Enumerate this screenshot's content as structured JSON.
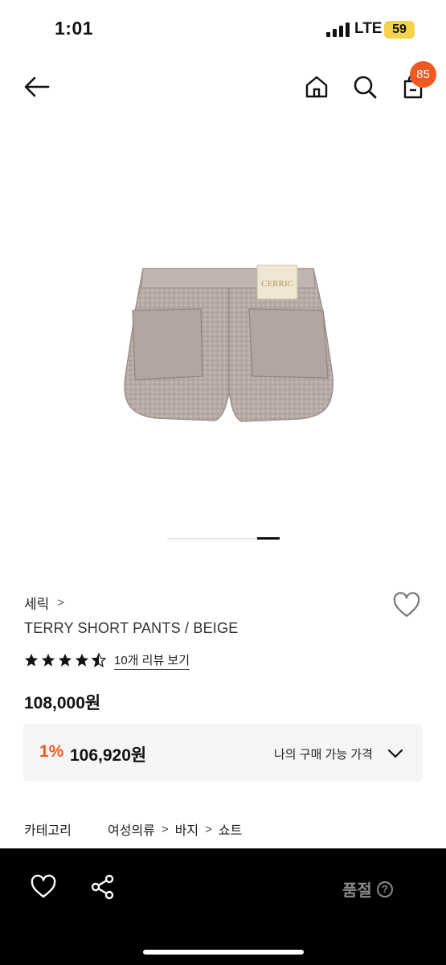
{
  "status_bar": {
    "time": "1:01",
    "network": "LTE",
    "battery": "59",
    "battery_color": "#f4d24b"
  },
  "header": {
    "cart_count": "85",
    "badge_color": "#f05a22",
    "icons": [
      "back-arrow-icon",
      "home-icon",
      "search-icon",
      "shopping-bag-icon"
    ]
  },
  "product": {
    "brand": "세릭",
    "brand_chevron": ">",
    "name": "TERRY SHORT PANTS / BEIGE",
    "label_text": "CERRIC",
    "rating": 4.5,
    "review_link": "10개 리뷰 보기",
    "price": "108,000원",
    "image_count": 2,
    "image_index": 2
  },
  "member_price": {
    "discount": "1%",
    "value": "106,920원",
    "label": "나의 구매 가능 가격",
    "accent_color": "#f05a22"
  },
  "category": {
    "label": "카테고리",
    "path": [
      "여성의류",
      "바지",
      "쇼트"
    ],
    "separator": ">"
  },
  "bottom_bar": {
    "status": "품절",
    "help": "?",
    "icons": [
      "heart-icon",
      "share-icon",
      "help-circle-icon"
    ]
  }
}
